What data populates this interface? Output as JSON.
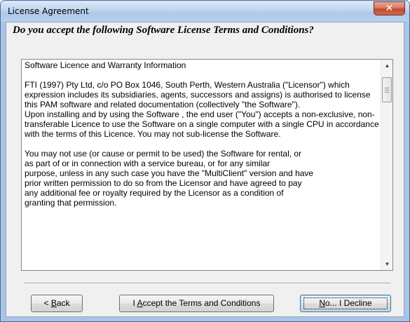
{
  "window": {
    "title": "License Agreement",
    "close_glyph": "✕"
  },
  "dialog": {
    "question": "Do you accept the following Software License Terms and Conditions?",
    "license_text": {
      "heading": "Software Licence and Warranty Information",
      "para1": "FTI (1997) Pty Ltd, c/o PO Box 1046, South Perth, Western Australia (\"Licensor\") which expression includes its subsidiaries, agents, successors and assigns) is authorised to license this PAM software and related documentation (collectively \"the Software\").",
      "para2": "Upon installing and by using the Software , the end user (\"You\") accepts a non-exclusive, non-transferable Licence to use the Software on a single computer with a single CPU in accordance with the terms of this Licence.  You may not sub-license the Software.",
      "para3_lines": [
        "You may not use (or cause or permit to be used) the Software for rental, or",
        "as part of or in connection with a service bureau, or for any similar",
        "purpose, unless in any such case you have the \"MultiClient\" version and have",
        "prior written permission to do so from the Licensor and have agreed to pay",
        "any additional fee or royalty required by the Licensor as a condition of",
        "granting that permission."
      ]
    },
    "scrollbar": {
      "up_arrow": "▲",
      "down_arrow": "▼",
      "position_fraction": 0.06
    }
  },
  "buttons": {
    "back": {
      "prefix": "< ",
      "mnemonic": "B",
      "rest": "ack"
    },
    "accept": {
      "prefix": "I ",
      "mnemonic": "A",
      "rest": "ccept the Terms and Conditions"
    },
    "decline": {
      "prefix": "",
      "mnemonic": "N",
      "rest": "o... I Decline"
    }
  }
}
